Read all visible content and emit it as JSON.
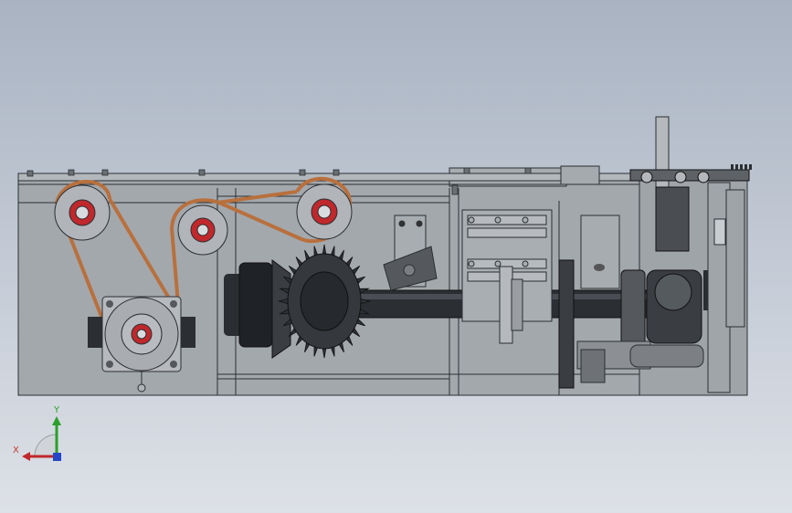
{
  "viewport": {
    "name": "cad-graphics-area",
    "background": {
      "top": "#a9b3c2",
      "bottom": "#dde1e7"
    }
  },
  "model": {
    "name": "gear-drive-assembly",
    "colors": {
      "frame_fill": "#a3a8ad",
      "frame_line": "#2b2f33",
      "belt": "#b8703d",
      "bearing_red": "#c0282b",
      "shaft_dark": "#1f2226",
      "gear_dark": "#3a3d42"
    },
    "components": [
      "timing-belt",
      "idler-pulley",
      "motor-pulley",
      "bevel-gear",
      "drive-shaft",
      "sprocket",
      "shaft-coupling",
      "gear-rack",
      "bearing-block"
    ]
  },
  "triad": {
    "x_label": "X",
    "y_label": "Y",
    "colors": {
      "x": "#c0282b",
      "y": "#2aa02a",
      "z": "#2247c8"
    }
  }
}
